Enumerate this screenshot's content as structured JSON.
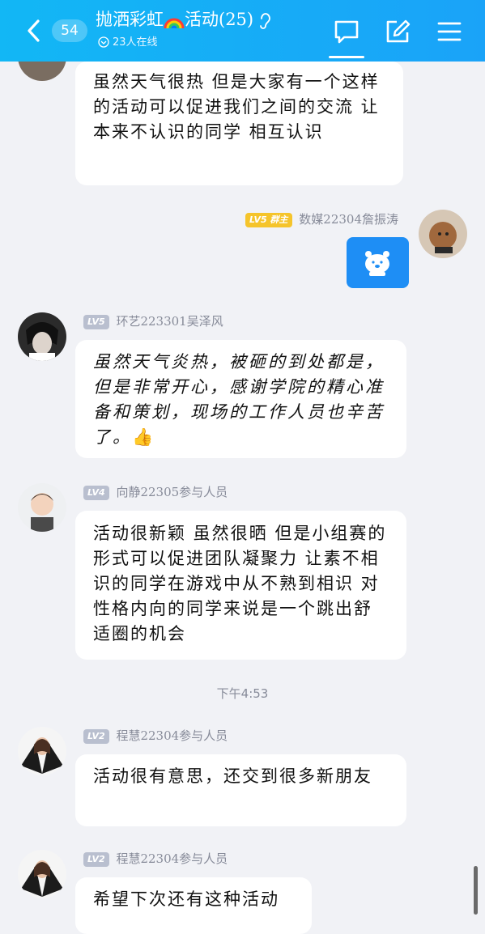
{
  "header": {
    "unread_count": "54",
    "title_prefix": "抛洒彩虹",
    "title_suffix": "活动(25)",
    "online_status": "23人在线",
    "icons": [
      "back-icon",
      "rainbow-emoji",
      "ear-icon",
      "chat-icon",
      "edit-icon",
      "menu-icon"
    ],
    "accent_color": "#12b7f5"
  },
  "messages": [
    {
      "text": "虽然天气很热 但是大家有一个这样的活动可以促进我们之间的交流 让本来不认识的同学 相互认识"
    },
    {
      "level": "LV5",
      "role": "群主",
      "sender": "数媒22304詹振涛",
      "type": "sticker"
    },
    {
      "level": "LV5",
      "sender": "环艺223301吴泽风",
      "text": "虽然天气炎热，被砸的到处都是，但是非常开心，感谢学院的精心准备和策划，现场的工作人员也辛苦了。"
    },
    {
      "level": "LV4",
      "sender": "向静22305参与人员",
      "text": "活动很新颖  虽然很晒 但是小组赛的形式可以促进团队凝聚力 让素不相识的同学在游戏中从不熟到相识 对性格内向的同学来说是一个跳出舒适圈的机会"
    },
    {
      "timestamp": "下午4:53"
    },
    {
      "level": "LV2",
      "sender": "程慧22304参与人员",
      "text": "活动很有意思，还交到很多新朋友"
    },
    {
      "level": "LV2",
      "sender": "程慧22304参与人员",
      "text": "希望下次还有这种活动"
    }
  ],
  "thumbs_up": "👍"
}
